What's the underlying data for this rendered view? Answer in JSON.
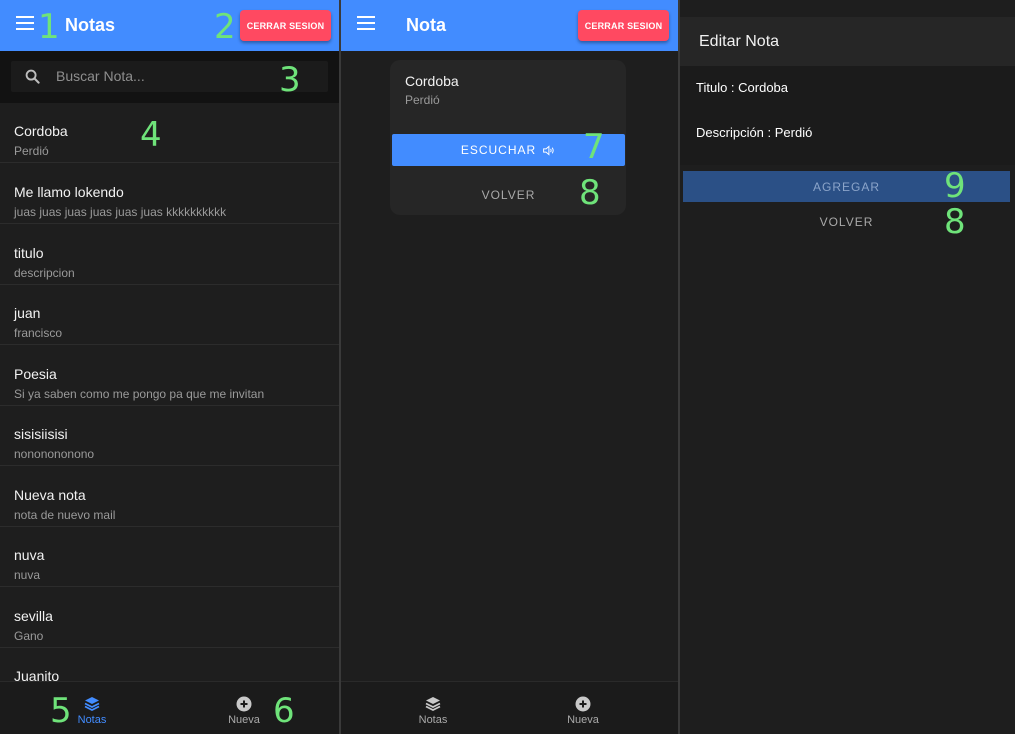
{
  "screen1": {
    "title": "Notas",
    "logout_label": "CERRAR SESION",
    "search_placeholder": "Buscar Nota...",
    "notes": [
      {
        "title": "Cordoba",
        "desc": "Perdió"
      },
      {
        "title": "Me llamo lokendo",
        "desc": "juas juas juas juas juas juas kkkkkkkkkk"
      },
      {
        "title": "titulo",
        "desc": "descripcion"
      },
      {
        "title": "juan",
        "desc": "francisco"
      },
      {
        "title": "Poesia",
        "desc": "Si ya saben como me pongo pa que me invitan"
      },
      {
        "title": "sisisiisisi",
        "desc": "nononononono"
      },
      {
        "title": "Nueva nota",
        "desc": "nota de nuevo mail"
      },
      {
        "title": "nuva",
        "desc": "nuva"
      },
      {
        "title": "sevilla",
        "desc": "Gano"
      },
      {
        "title": "Juanito",
        "desc": ""
      }
    ],
    "tabs": {
      "notes": "Notas",
      "new": "Nueva"
    }
  },
  "screen2": {
    "title": "Nota",
    "logout_label": "CERRAR SESION",
    "note_title": "Cordoba",
    "note_desc": "Perdió",
    "listen_label": "ESCUCHAR",
    "back_label": "VOLVER",
    "tabs": {
      "notes": "Notas",
      "new": "Nueva"
    }
  },
  "screen3": {
    "header": "Editar Nota",
    "title_field": "Titulo :  Cordoba",
    "desc_field": "Descripción :  Perdió",
    "add_label": "AGREGAR",
    "back_label": "VOLVER"
  },
  "callouts": {
    "c1": "1",
    "c2": "2",
    "c3": "3",
    "c4": "4",
    "c5": "5",
    "c6": "6",
    "c7": "7",
    "c8a": "8",
    "c8b": "8",
    "c9": "9"
  },
  "colors": {
    "primary": "#428cff",
    "danger": "#ff4961",
    "background": "#1e1e1e",
    "callout": "#6fe37a"
  }
}
